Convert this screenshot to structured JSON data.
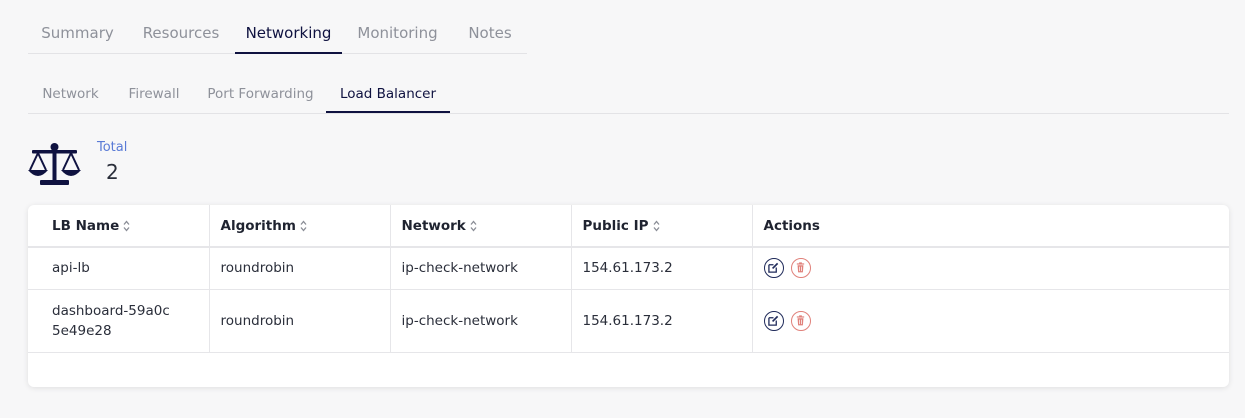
{
  "primary_tabs": [
    {
      "label": "Summary"
    },
    {
      "label": "Resources"
    },
    {
      "label": "Networking"
    },
    {
      "label": "Monitoring"
    },
    {
      "label": "Notes"
    }
  ],
  "active_primary_tab": "Networking",
  "secondary_tabs": [
    {
      "label": "Network"
    },
    {
      "label": "Firewall"
    },
    {
      "label": "Port Forwarding"
    },
    {
      "label": "Load Balancer"
    }
  ],
  "active_secondary_tab": "Load Balancer",
  "summary": {
    "icon": "balance-scale-icon",
    "total_label": "Total",
    "total_value": "2"
  },
  "table": {
    "columns": [
      {
        "label": "LB Name",
        "sortable": true
      },
      {
        "label": "Algorithm",
        "sortable": true
      },
      {
        "label": "Network",
        "sortable": true
      },
      {
        "label": "Public IP",
        "sortable": true
      },
      {
        "label": "Actions",
        "sortable": false
      }
    ],
    "rows": [
      {
        "name": "api-lb",
        "algorithm": "roundrobin",
        "network": "ip-check-network",
        "public_ip": "154.61.173.2"
      },
      {
        "name": "dashboard-59a0c5e49e28",
        "algorithm": "roundrobin",
        "network": "ip-check-network",
        "public_ip": "154.61.173.2"
      }
    ],
    "actions": [
      "edit-icon",
      "trash-icon"
    ]
  },
  "colors": {
    "accent": "#0f1240",
    "total_label": "#5a7bd6",
    "delete": "#e0807a"
  }
}
